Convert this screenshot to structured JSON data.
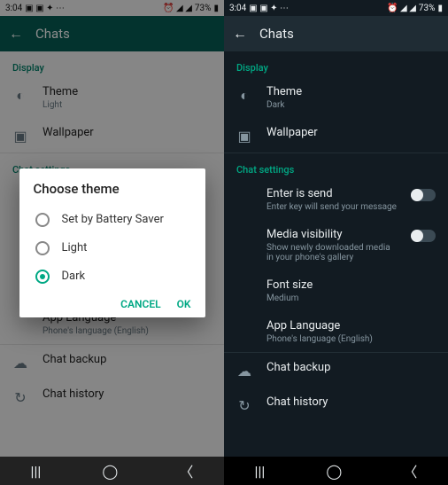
{
  "status": {
    "time": "3:04",
    "battery": "73%"
  },
  "appbar": {
    "title": "Chats"
  },
  "sections": {
    "display": "Display",
    "chat_settings": "Chat settings"
  },
  "theme_row": {
    "title": "Theme",
    "value_left": "Light",
    "value_right": "Dark"
  },
  "wallpaper": "Wallpaper",
  "enter_send": {
    "title": "Enter is send",
    "sub": "Enter key will send your message",
    "on": false
  },
  "media_vis": {
    "title": "Media visibility",
    "sub": "Show newly downloaded media in your phone's gallery",
    "on": false
  },
  "font_size": {
    "title": "Font size",
    "value": "Medium"
  },
  "app_lang": {
    "title": "App Language",
    "value": "Phone's language (English)"
  },
  "chat_backup": "Chat backup",
  "chat_history": "Chat history",
  "dialog": {
    "title": "Choose theme",
    "opt_saver": "Set by Battery Saver",
    "opt_light": "Light",
    "opt_dark": "Dark",
    "cancel": "CANCEL",
    "ok": "OK",
    "selected": "dark"
  }
}
